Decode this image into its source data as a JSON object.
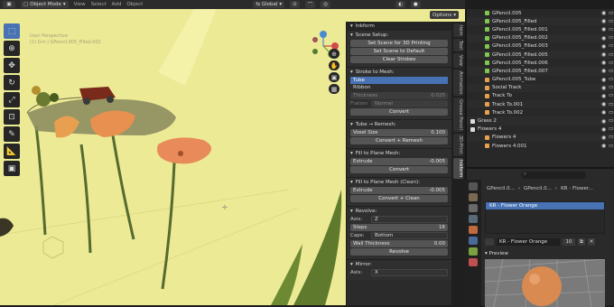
{
  "header": {
    "mode_label": "Object Mode",
    "menus": [
      "View",
      "Select",
      "Add",
      "Object"
    ],
    "orientation_label": "Global",
    "options_label": "Options"
  },
  "viewport": {
    "perspective_text": "User Perspective",
    "collection_text": "(1) Grn | GPencil.005_Filled.002"
  },
  "inkform": {
    "title": "Inkform",
    "scene_setup": {
      "heading": "Scene Setup:",
      "buttons": [
        "Set Scene for 3D Printing",
        "Set Scene to Default",
        "Clear Strokes"
      ]
    },
    "stroke_to_mesh": {
      "heading": "Stroke to Mesh:",
      "items": [
        "Tube",
        "Ribbon"
      ],
      "thickness_label": "Thickness",
      "thickness_value": "0.025",
      "flatten_label": "Flatten",
      "flatten_value": "Normal",
      "convert_label": "Convert"
    },
    "tube_remesh": {
      "heading": "Tube → Remesh:",
      "voxel_label": "Voxel Size",
      "voxel_value": "0.100",
      "button": "Convert + Remesh"
    },
    "fill_plane": {
      "heading": "Fill to Plane Mesh:",
      "extrude_label": "Extrude",
      "extrude_value": "-0.005",
      "button": "Convert"
    },
    "fill_plane_clean": {
      "heading": "Fill to Plane Mesh (Clean):",
      "extrude_label": "Extrude",
      "extrude_value": "-0.005",
      "button": "Convert + Clean"
    },
    "revolve": {
      "heading": "Revolve:",
      "axis_label": "Axis:",
      "axis_value": "Z",
      "steps_label": "Steps",
      "steps_value": "16",
      "caps_label": "Caps:",
      "caps_value": "Bottom",
      "wall_label": "Wall Thickness",
      "wall_value": "0.00",
      "button": "Revolve"
    },
    "mirror": {
      "heading": "Mirror:",
      "axis_label": "Axis:",
      "axis_value": "X"
    }
  },
  "vertical_tabs": [
    "Item",
    "Tool",
    "View",
    "Animation",
    "Grease Pencil",
    "3D-Print",
    "Inkform"
  ],
  "outliner": {
    "rows": [
      {
        "name": "GPencil.005",
        "color": "#7ec850"
      },
      {
        "name": "GPencil.005_Filled",
        "color": "#7ec850"
      },
      {
        "name": "GPencil.005_Filled.001",
        "color": "#7ec850"
      },
      {
        "name": "GPencil.005_Filled.002",
        "color": "#7ec850"
      },
      {
        "name": "GPencil.005_Filled.003",
        "color": "#7ec850"
      },
      {
        "name": "GPencil.005_Filled.005",
        "color": "#7ec850"
      },
      {
        "name": "GPencil.005_Filled.006",
        "color": "#7ec850"
      },
      {
        "name": "GPencil.005_Filled.007",
        "color": "#7ec850"
      },
      {
        "name": "GPencil.005_Tube",
        "color": "#e8a050"
      },
      {
        "name": "Social Track",
        "color": "#e8a050"
      },
      {
        "name": "Track To",
        "color": "#e8a050"
      },
      {
        "name": "Track To.001",
        "color": "#e8a050"
      },
      {
        "name": "Track To.002",
        "color": "#e8a050"
      },
      {
        "name": "Grass 2",
        "color": "#ddd"
      },
      {
        "name": "Flowers 4",
        "color": "#ddd"
      },
      {
        "name": "Flowers 4",
        "color": "#e8a050"
      },
      {
        "name": "Flowers 4.001",
        "color": "#e8a050"
      }
    ]
  },
  "properties": {
    "breadcrumb": [
      "GPencil.0...",
      "GPencil.0...",
      "KR - Flower..."
    ],
    "material_slot": "KR - Flower Orange",
    "material_name": "KR - Flower Orange",
    "user_count": "10",
    "preview_label": "Preview"
  }
}
